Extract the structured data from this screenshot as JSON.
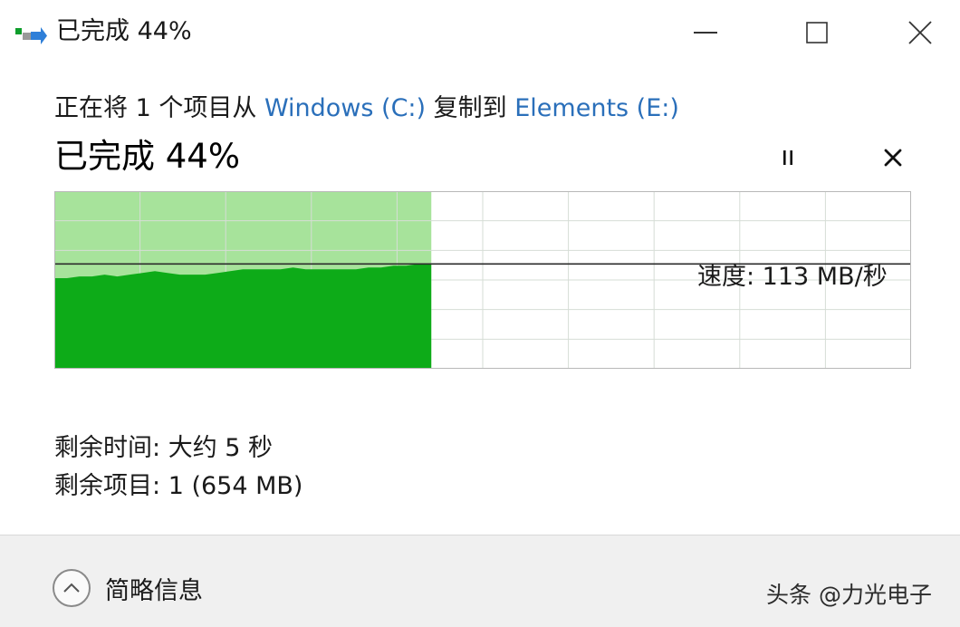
{
  "window": {
    "title": "已完成 44%",
    "buttons": {
      "minimize": "minimize-icon",
      "maximize": "maximize-icon",
      "close": "close-icon"
    }
  },
  "copy": {
    "description_prefix": "正在将 1 个项目从",
    "source": "Windows (C:)",
    "description_middle": "复制到",
    "destination": "Elements (E:)",
    "status": "已完成 44%",
    "progress": 0.44
  },
  "controls": {
    "pause": "pause-icon",
    "cancel": "cancel-icon"
  },
  "graph": {
    "speed_label": "速度: 113 MB/秒",
    "speed_fraction": 0.41,
    "speed_history": [
      0.49,
      0.49,
      0.48,
      0.48,
      0.47,
      0.48,
      0.47,
      0.46,
      0.45,
      0.46,
      0.47,
      0.47,
      0.47,
      0.46,
      0.45,
      0.44,
      0.44,
      0.44,
      0.44,
      0.43,
      0.44,
      0.44,
      0.44,
      0.44,
      0.44,
      0.43,
      0.43,
      0.42,
      0.42,
      0.41,
      0.41
    ],
    "colors": {
      "fill_area": "#a7e39b",
      "speed_area": "#0dab18",
      "grid": "#d6ddd6",
      "speed_line": "#2b2b2b",
      "border": "#b8b8b8"
    }
  },
  "details": {
    "time_remaining_label": "剩余时间:",
    "time_remaining_value": "大约 5 秒",
    "items_remaining_label": "剩余项目:",
    "items_remaining_value": "1 (654 MB)"
  },
  "footer": {
    "toggle_icon": "chevron-up-icon",
    "toggle_label": "简略信息",
    "watermark": "头条 @力光电子"
  }
}
